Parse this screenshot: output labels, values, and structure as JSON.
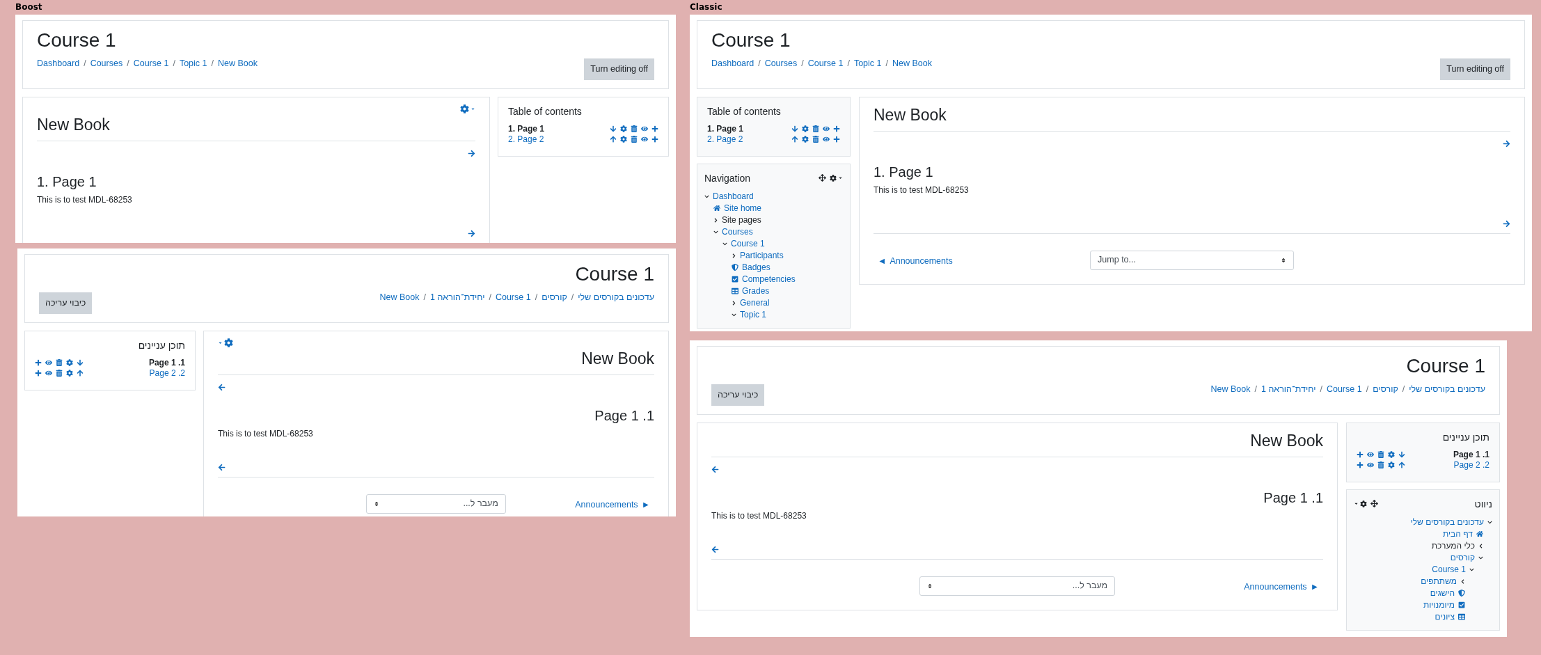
{
  "columns": [
    {
      "label": "Boost",
      "screens": [
        {
          "kind": "boost",
          "rtl": false,
          "heading": "Course 1",
          "breadcrumb": {
            "separator": "/",
            "items": [
              "Dashboard",
              "Courses",
              "Course 1",
              "Topic 1",
              "New Book"
            ]
          },
          "edit_button": "Turn editing off",
          "book": {
            "title": "New Book",
            "settings_menu": true,
            "top_next_arrow": true,
            "chapter_title": "1. Page 1",
            "text": "This is to test MDL-68253",
            "bottom_next_arrow": true
          },
          "toc": {
            "title": "Table of contents",
            "items": [
              {
                "label": "1. Page 1",
                "selected": true,
                "kind": "down"
              },
              {
                "label": "2. Page 2",
                "selected": false,
                "kind": "up"
              }
            ]
          }
        },
        {
          "kind": "boost",
          "rtl": true,
          "heading": "Course 1",
          "breadcrumb": {
            "separator": "/",
            "items": [
              "עדכונים בקורסים שלי",
              "קורסים",
              "Course 1",
              "יחידת־הוראה 1",
              "New Book"
            ]
          },
          "edit_button": "כיבוי עריכה",
          "book": {
            "title": "New Book",
            "settings_menu": true,
            "top_next_arrow": true,
            "chapter_title": "1. Page 1",
            "text": "This is to test MDL-68253",
            "bottom_next_arrow": true,
            "footer": {
              "arrow": "►",
              "link": "Announcements",
              "jump_placeholder": "מעבר ל..."
            }
          },
          "toc": {
            "title": "תוכן עניינים",
            "items": [
              {
                "label": "1. Page 1",
                "selected": true,
                "kind": "down"
              },
              {
                "label": "2. Page 2",
                "selected": false,
                "kind": "up"
              }
            ]
          }
        }
      ]
    },
    {
      "label": "Classic",
      "screens": [
        {
          "kind": "classic",
          "rtl": false,
          "heading": "Course 1",
          "breadcrumb": {
            "separator": "/",
            "items": [
              "Dashboard",
              "Courses",
              "Course 1",
              "Topic 1",
              "New Book"
            ]
          },
          "edit_button": "Turn editing off",
          "book": {
            "title": "New Book",
            "settings_menu": false,
            "top_next_arrow": true,
            "chapter_title": "1. Page 1",
            "text": "This is to test MDL-68253",
            "bottom_next_arrow": true,
            "footer": {
              "arrow": "◄",
              "link": "Announcements",
              "jump_placeholder": "Jump to..."
            }
          },
          "toc": {
            "title": "Table of contents",
            "items": [
              {
                "label": "1. Page 1",
                "selected": true,
                "kind": "down"
              },
              {
                "label": "2. Page 2",
                "selected": false,
                "kind": "up"
              }
            ]
          },
          "navigation": {
            "title": "Navigation",
            "items": [
              {
                "label": "Dashboard",
                "kind": "branch",
                "expanded": true,
                "link": true,
                "children": [
                  {
                    "label": "Site home",
                    "kind": "home",
                    "link": true
                  },
                  {
                    "label": "Site pages",
                    "kind": "branch",
                    "expanded": false,
                    "link": false
                  },
                  {
                    "label": "Courses",
                    "kind": "branch",
                    "expanded": true,
                    "link": true,
                    "children": [
                      {
                        "label": "Course 1",
                        "kind": "branch",
                        "expanded": true,
                        "link": true,
                        "children": [
                          {
                            "label": "Participants",
                            "kind": "branch",
                            "expanded": false,
                            "link": true
                          },
                          {
                            "label": "Badges",
                            "kind": "badge",
                            "link": true
                          },
                          {
                            "label": "Competencies",
                            "kind": "competency",
                            "link": true
                          },
                          {
                            "label": "Grades",
                            "kind": "grades",
                            "link": true
                          },
                          {
                            "label": "General",
                            "kind": "branch",
                            "expanded": false,
                            "link": true
                          },
                          {
                            "label": "Topic 1",
                            "kind": "branch",
                            "expanded": true,
                            "link": true
                          }
                        ]
                      }
                    ]
                  }
                ]
              }
            ]
          }
        },
        {
          "kind": "classic",
          "rtl": true,
          "heading": "Course 1",
          "breadcrumb": {
            "separator": "/",
            "items": [
              "עדכונים בקורסים שלי",
              "קורסים",
              "Course 1",
              "יחידת־הוראה 1",
              "New Book"
            ]
          },
          "edit_button": "כיבוי עריכה",
          "book": {
            "title": "New Book",
            "settings_menu": false,
            "top_next_arrow": true,
            "chapter_title": "1. Page 1",
            "text": "This is to test MDL-68253",
            "bottom_next_arrow": true,
            "footer": {
              "arrow": "►",
              "link": "Announcements",
              "jump_placeholder": "מעבר ל..."
            }
          },
          "toc": {
            "title": "תוכן עניינים",
            "items": [
              {
                "label": "1. Page 1",
                "selected": true,
                "kind": "down"
              },
              {
                "label": "2. Page 2",
                "selected": false,
                "kind": "up"
              }
            ]
          },
          "navigation": {
            "title": "ניווט",
            "items": [
              {
                "label": "עדכונים בקורסים שלי",
                "kind": "branch",
                "expanded": true,
                "link": true,
                "children": [
                  {
                    "label": "דף הבית",
                    "kind": "home",
                    "link": true
                  },
                  {
                    "label": "כלי המערכת",
                    "kind": "branch",
                    "expanded": false,
                    "link": false
                  },
                  {
                    "label": "קורסים",
                    "kind": "branch",
                    "expanded": true,
                    "link": true,
                    "children": [
                      {
                        "label": "Course 1",
                        "kind": "branch",
                        "expanded": true,
                        "link": true,
                        "children": [
                          {
                            "label": "משתתפים",
                            "kind": "branch",
                            "expanded": false,
                            "link": true
                          },
                          {
                            "label": "הישגים",
                            "kind": "badge",
                            "link": true
                          },
                          {
                            "label": "מיומנויות",
                            "kind": "competency",
                            "link": true
                          },
                          {
                            "label": "ציונים",
                            "kind": "grades",
                            "link": true
                          }
                        ]
                      }
                    ]
                  }
                ]
              }
            ]
          }
        }
      ]
    }
  ]
}
